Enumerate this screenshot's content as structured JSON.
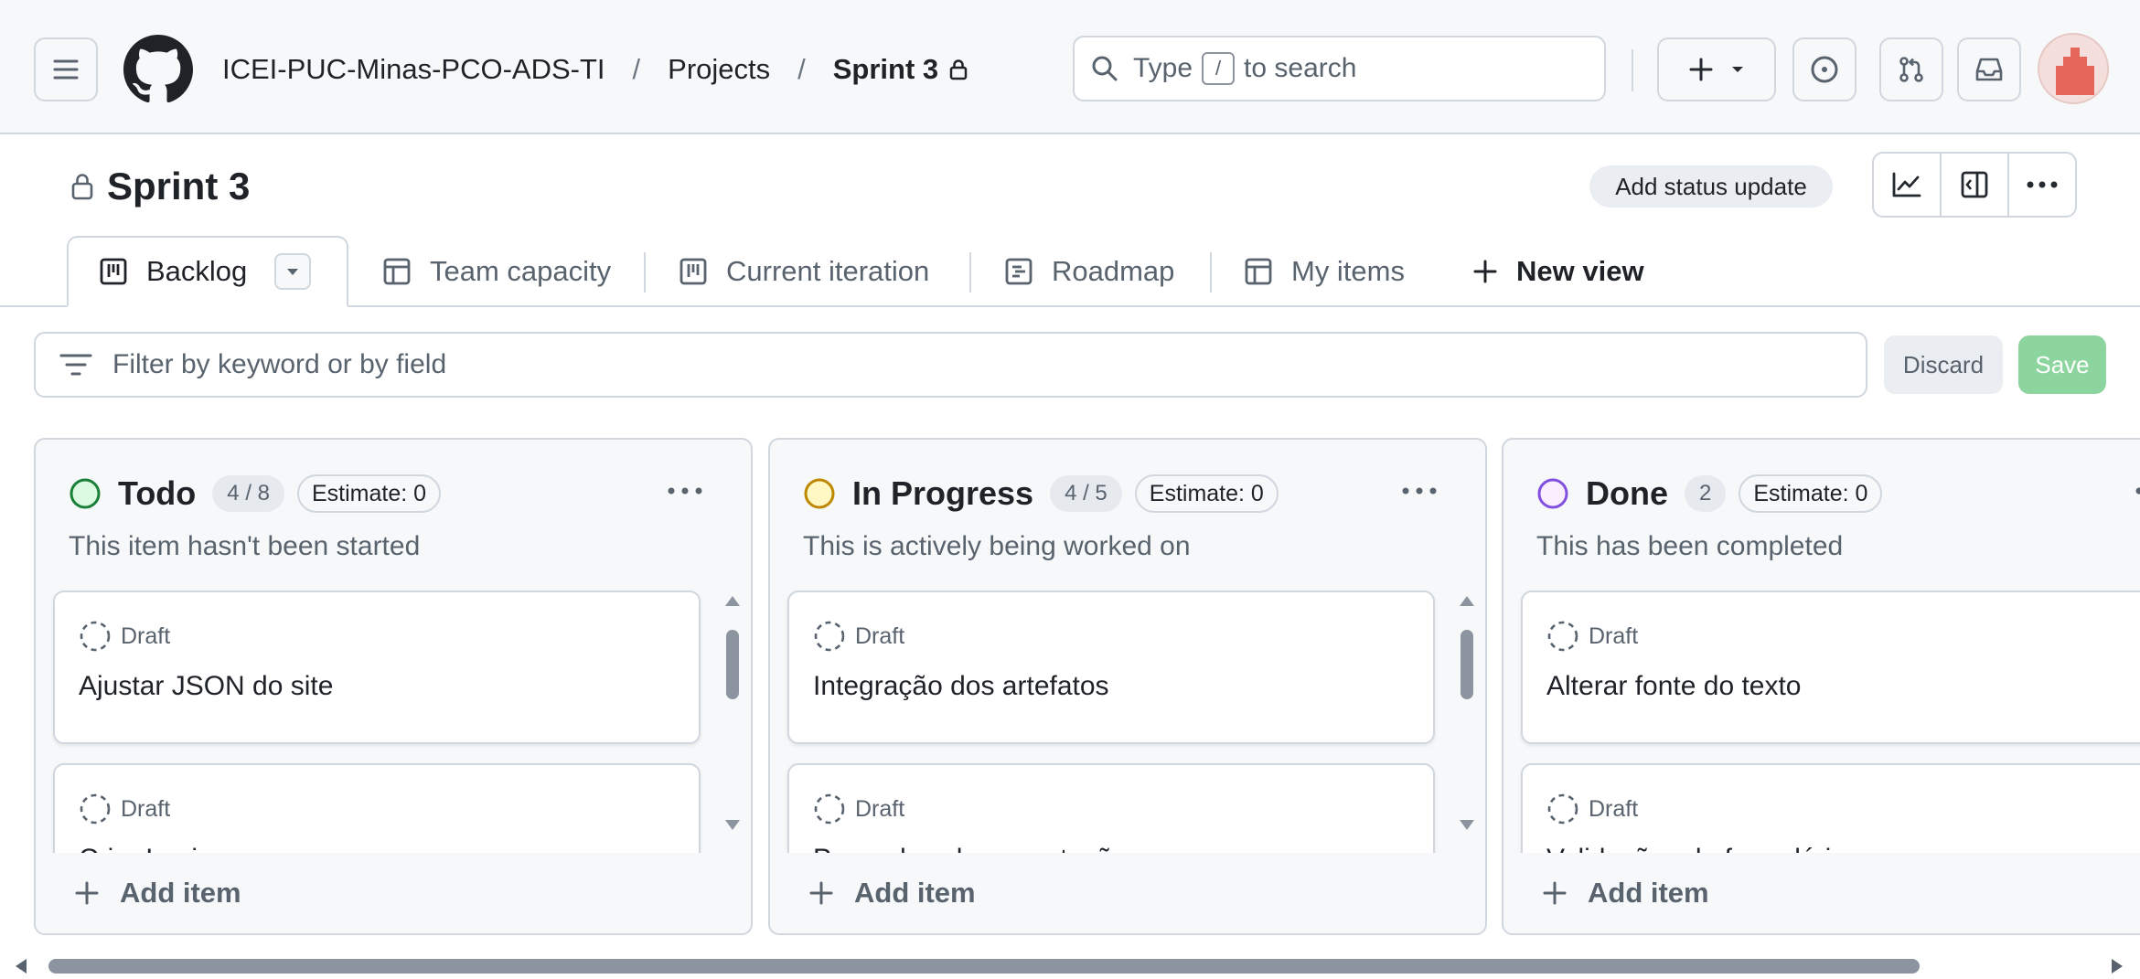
{
  "header": {
    "breadcrumb": {
      "org": "ICEI-PUC-Minas-PCO-ADS-TI",
      "separator": "/",
      "projects": "Projects",
      "current": "Sprint 3"
    },
    "search": {
      "prefix": "Type",
      "key": "/",
      "suffix": "to search"
    },
    "create_label": "+"
  },
  "project": {
    "title": "Sprint 3",
    "status_update_label": "Add status update"
  },
  "tabs": [
    {
      "label": "Backlog",
      "icon": "board-icon",
      "active": true
    },
    {
      "label": "Team capacity",
      "icon": "table-icon"
    },
    {
      "label": "Current iteration",
      "icon": "board-icon"
    },
    {
      "label": "Roadmap",
      "icon": "roadmap-icon"
    },
    {
      "label": "My items",
      "icon": "table-icon"
    },
    {
      "label": "New view",
      "icon": "plus-icon"
    }
  ],
  "filter": {
    "placeholder": "Filter by keyword or by field",
    "discard_label": "Discard",
    "save_label": "Save"
  },
  "columns": [
    {
      "title": "Todo",
      "count": "4 / 8",
      "estimate": "Estimate: 0",
      "description": "This item hasn't been started",
      "status_color": "#1a7f37",
      "cards": [
        {
          "kind": "Draft",
          "title": "Ajustar JSON do site"
        },
        {
          "kind": "Draft",
          "title": "Criar Login"
        }
      ],
      "add_label": "Add item"
    },
    {
      "title": "In Progress",
      "count": "4 / 5",
      "estimate": "Estimate: 0",
      "description": "This is actively being worked on",
      "status_color": "#bf8700",
      "cards": [
        {
          "kind": "Draft",
          "title": "Integração dos artefatos"
        },
        {
          "kind": "Draft",
          "title": "Preencher documentação"
        }
      ],
      "add_label": "Add item"
    },
    {
      "title": "Done",
      "count": "2",
      "estimate": "Estimate: 0",
      "description": "This has been completed",
      "status_color": "#8250df",
      "cards": [
        {
          "kind": "Draft",
          "title": "Alterar fonte do texto"
        },
        {
          "kind": "Draft",
          "title": "Validações do formulário"
        }
      ],
      "add_label": "Add item"
    }
  ],
  "colors": {
    "accent_green": "#1a7f37",
    "accent_yellow": "#bf8700",
    "accent_purple": "#8250df",
    "save_button": "#8dd59f",
    "avatar": "#e5675c"
  }
}
